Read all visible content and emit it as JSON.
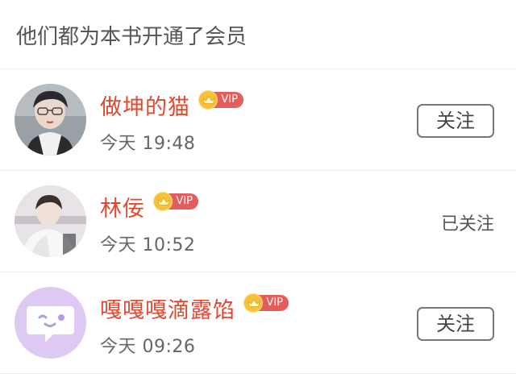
{
  "header": {
    "title": "他们都为本书开通了会员"
  },
  "badge": {
    "vip_label": "VIP",
    "crown_color": "#f6c23a",
    "pill_color": "#e45c5c"
  },
  "colors": {
    "username": "#e0482f",
    "divider": "#ededed"
  },
  "members": [
    {
      "name": "做坤的猫",
      "time": "今天 19:48",
      "follow_state": "关注",
      "avatar": "photo-boy-glasses"
    },
    {
      "name": "林佞",
      "time": "今天 10:52",
      "follow_state": "已关注",
      "avatar": "photo-boy-white-coat"
    },
    {
      "name": "嘎嘎嘎滴露馅",
      "time": "今天 09:26",
      "follow_state": "关注",
      "avatar": "chat-bubble-face-icon"
    }
  ]
}
